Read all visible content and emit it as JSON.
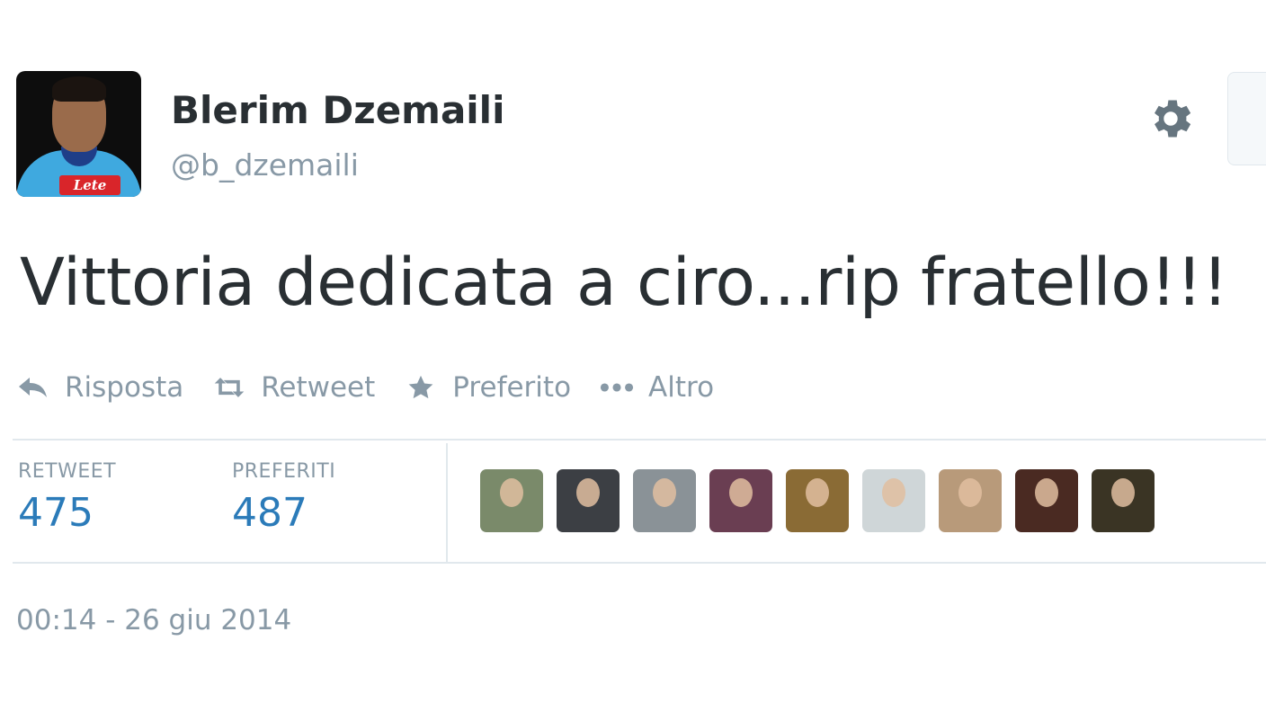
{
  "user": {
    "name": "Blerim Dzemaili",
    "handle": "@b_dzemaili",
    "avatar_shirt_text": "Lete"
  },
  "tweet": {
    "text": "Vittoria dedicata a ciro...rip fratello!!!"
  },
  "actions": [
    {
      "icon": "reply-icon",
      "label": "Risposta"
    },
    {
      "icon": "retweet-icon",
      "label": "Retweet"
    },
    {
      "icon": "star-icon",
      "label": "Preferito"
    },
    {
      "icon": "more-icon",
      "label": "Altro"
    }
  ],
  "stats": {
    "retweets_label": "RETWEET",
    "retweets_count": "475",
    "favorites_label": "PREFERITI",
    "favorites_count": "487"
  },
  "favoriters": [
    {
      "color": "#7a8a6a"
    },
    {
      "color": "#3c3f44"
    },
    {
      "color": "#8a9297"
    },
    {
      "color": "#6a3e52"
    },
    {
      "color": "#8a6b35"
    },
    {
      "color": "#cfd6d8"
    },
    {
      "color": "#b89a7a"
    },
    {
      "color": "#4a2a22"
    },
    {
      "color": "#3a3424"
    }
  ],
  "timestamp": "00:14 - 26 giu 2014",
  "colors": {
    "text": "#292f33",
    "muted": "#8899a6",
    "link": "#2b7bb9",
    "border": "#e1e8ed"
  }
}
